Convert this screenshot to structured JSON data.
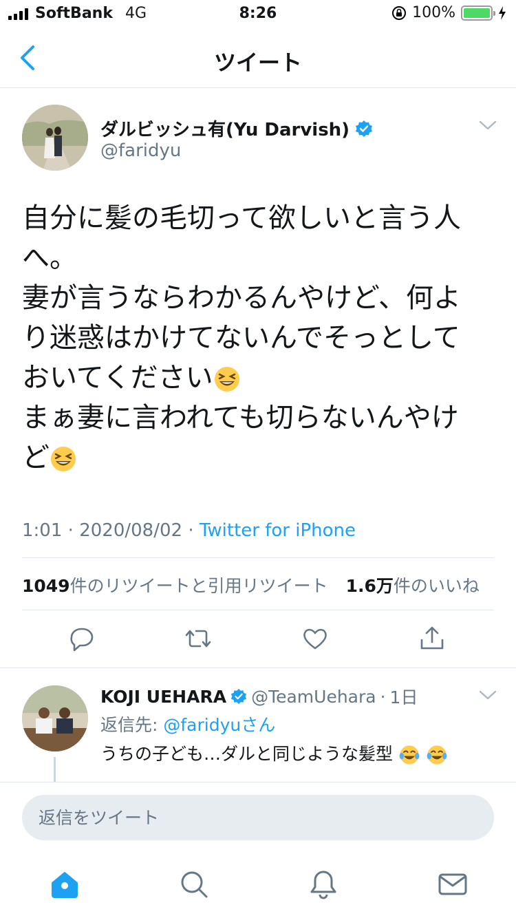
{
  "status_bar": {
    "carrier": "SoftBank",
    "network": "4G",
    "time": "8:26",
    "battery": "100%",
    "battery_level": 1.0
  },
  "nav": {
    "title": "ツイート",
    "back_icon": "chevron-left-icon"
  },
  "tweet": {
    "author_name": "ダルビッシュ有(Yu Darvish)",
    "handle": "@faridyu",
    "lines": [
      "自分に髪の毛切って欲しいと言う人",
      "へ。",
      "妻が言うならわかるんやけど、何よ",
      "り迷惑はかけてないんでそっとして",
      "おいてください",
      "まぁ妻に言われても切らないんやけ",
      "ど"
    ],
    "time": "1:01",
    "date": "2020/08/02",
    "source": "Twitter for iPhone",
    "retweet_count": "1049",
    "retweet_label": "件のリツイートと引用リツイート",
    "like_count": "1.6万",
    "like_label": "件のいいね"
  },
  "reply": {
    "name": "KOJI  UEHARA",
    "handle": "@TeamUehara",
    "age": "1日",
    "reply_to_prefix": "返信先: ",
    "reply_to_handle": "@faridyuさん",
    "text": "うちの子ども…ダルと同じような髪型"
  },
  "reply_box": {
    "placeholder": "返信をツイート"
  },
  "tab_bar": {
    "items": [
      "home-icon",
      "search-icon",
      "notifications-icon",
      "messages-icon"
    ]
  },
  "colors": {
    "accent": "#1da1f2",
    "text": "#14171a",
    "muted": "#657786",
    "divider": "#e1e8ed",
    "battery": "#4cd964"
  }
}
